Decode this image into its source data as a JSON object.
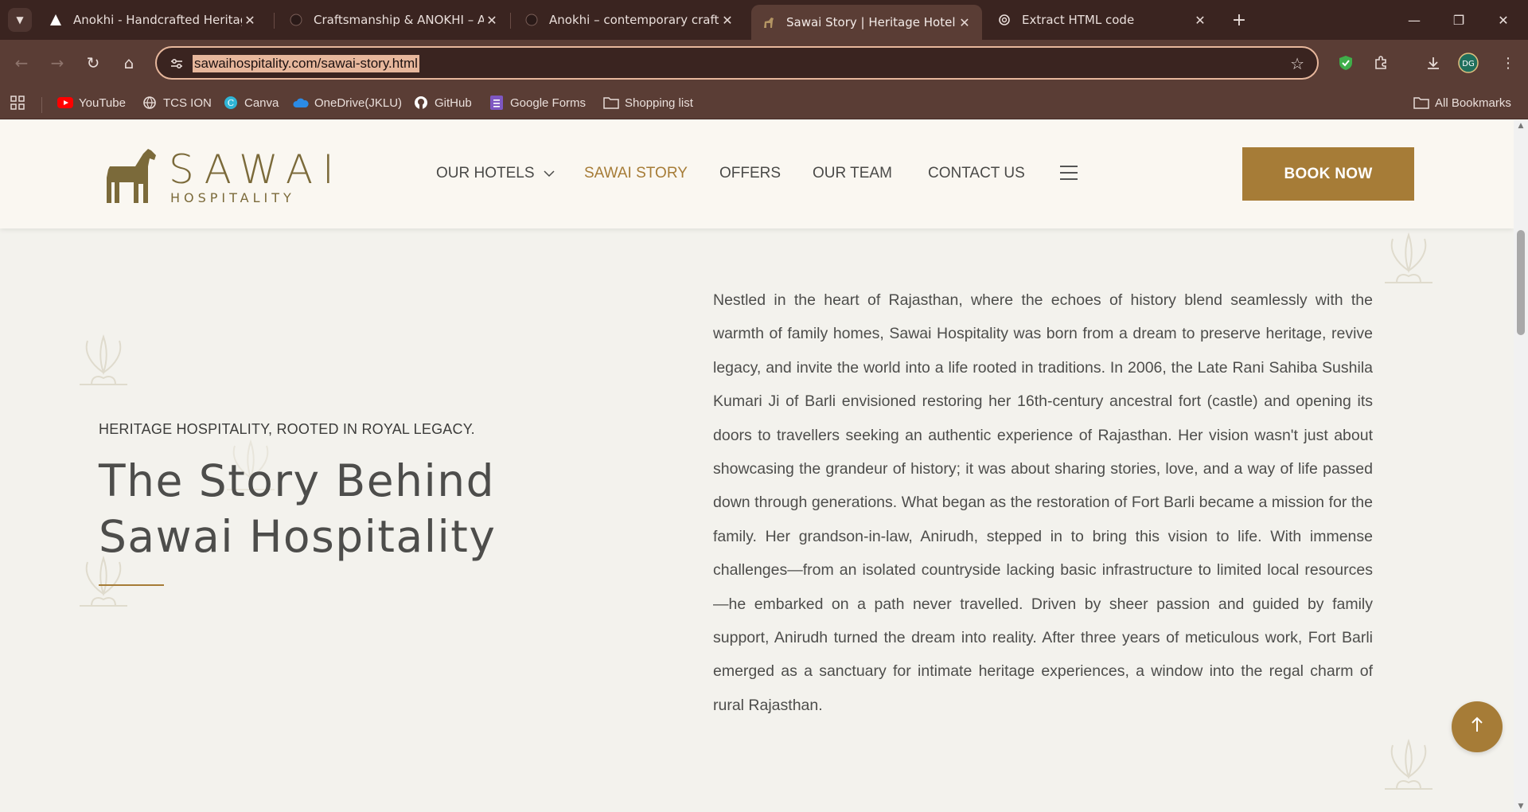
{
  "browser": {
    "tabs": [
      {
        "title": "Anokhi - Handcrafted Heritage,",
        "icon": "anokhi-icon",
        "active": false
      },
      {
        "title": "Craftsmanship & ANOKHI – An",
        "icon": "anokhi-icon",
        "active": false
      },
      {
        "title": "Anokhi – contemporary crafted",
        "icon": "anokhi-icon",
        "active": false
      },
      {
        "title": "Sawai Story | Heritage Hotel in I",
        "icon": "sawai-horse-icon",
        "active": true
      },
      {
        "title": "Extract HTML code",
        "icon": "chatgpt-icon",
        "active": false
      }
    ],
    "url": "sawaihospitality.com/sawai-story.html",
    "bookmarks": [
      {
        "label": "YouTube",
        "icon": "youtube-icon",
        "color": "#ff0000"
      },
      {
        "label": "TCS ION",
        "icon": "tcs-icon",
        "color": "#e8dcd8"
      },
      {
        "label": "Canva",
        "icon": "canva-icon",
        "color": "#2fb5d6"
      },
      {
        "label": "OneDrive(JKLU)",
        "icon": "onedrive-icon",
        "color": "#2b8be6"
      },
      {
        "label": "GitHub",
        "icon": "github-icon",
        "color": "#ffffff"
      },
      {
        "label": "Google Forms",
        "icon": "google-forms-icon",
        "color": "#7e57c2"
      },
      {
        "label": "Shopping list",
        "icon": "folder-icon",
        "color": "#e8dcd8"
      }
    ],
    "all_bookmarks": "All Bookmarks",
    "profile_initials": "DG"
  },
  "site": {
    "logo": {
      "name": "SAWAI",
      "sub": "HOSPITALITY"
    },
    "nav": [
      {
        "label": "OUR HOTELS",
        "has_dropdown": true,
        "active": false
      },
      {
        "label": "SAWAI STORY",
        "has_dropdown": false,
        "active": true
      },
      {
        "label": "OFFERS",
        "has_dropdown": false,
        "active": false
      },
      {
        "label": "OUR TEAM",
        "has_dropdown": false,
        "active": false
      },
      {
        "label": "CONTACT US",
        "has_dropdown": false,
        "active": false
      }
    ],
    "book_now": "BOOK NOW",
    "accent_color": "#a67c37"
  },
  "main": {
    "eyebrow": "HERITAGE HOSPITALITY, ROOTED IN ROYAL LEGACY.",
    "heading_line1": "The Story Behind",
    "heading_line2": "Sawai Hospitality",
    "story": "Nestled in the heart of Rajasthan, where the echoes of history blend seamlessly with the warmth of family homes, Sawai Hospitality was born from a dream to preserve heritage, revive legacy, and invite the world into a life rooted in traditions. In 2006, the Late Rani Sahiba Sushila Kumari Ji of Barli envisioned restoring her 16th-century ancestral fort (castle) and opening its doors to travellers seeking an authentic experience of Rajasthan. Her vision wasn't just about showcasing the grandeur of history; it was about sharing stories, love, and a way of life passed down through generations. What began as the restoration of Fort Barli became a mission for the family. Her grandson-in-law, Anirudh, stepped in to bring this vision to life. With immense challenges—from an isolated countryside lacking basic infrastructure to limited local resources—he embarked on a path never travelled. Driven by sheer passion and guided by family support, Anirudh turned the dream into reality. After three years of meticulous work, Fort Barli emerged as a sanctuary for intimate heritage experiences, a window into the regal charm of rural Rajasthan."
  }
}
